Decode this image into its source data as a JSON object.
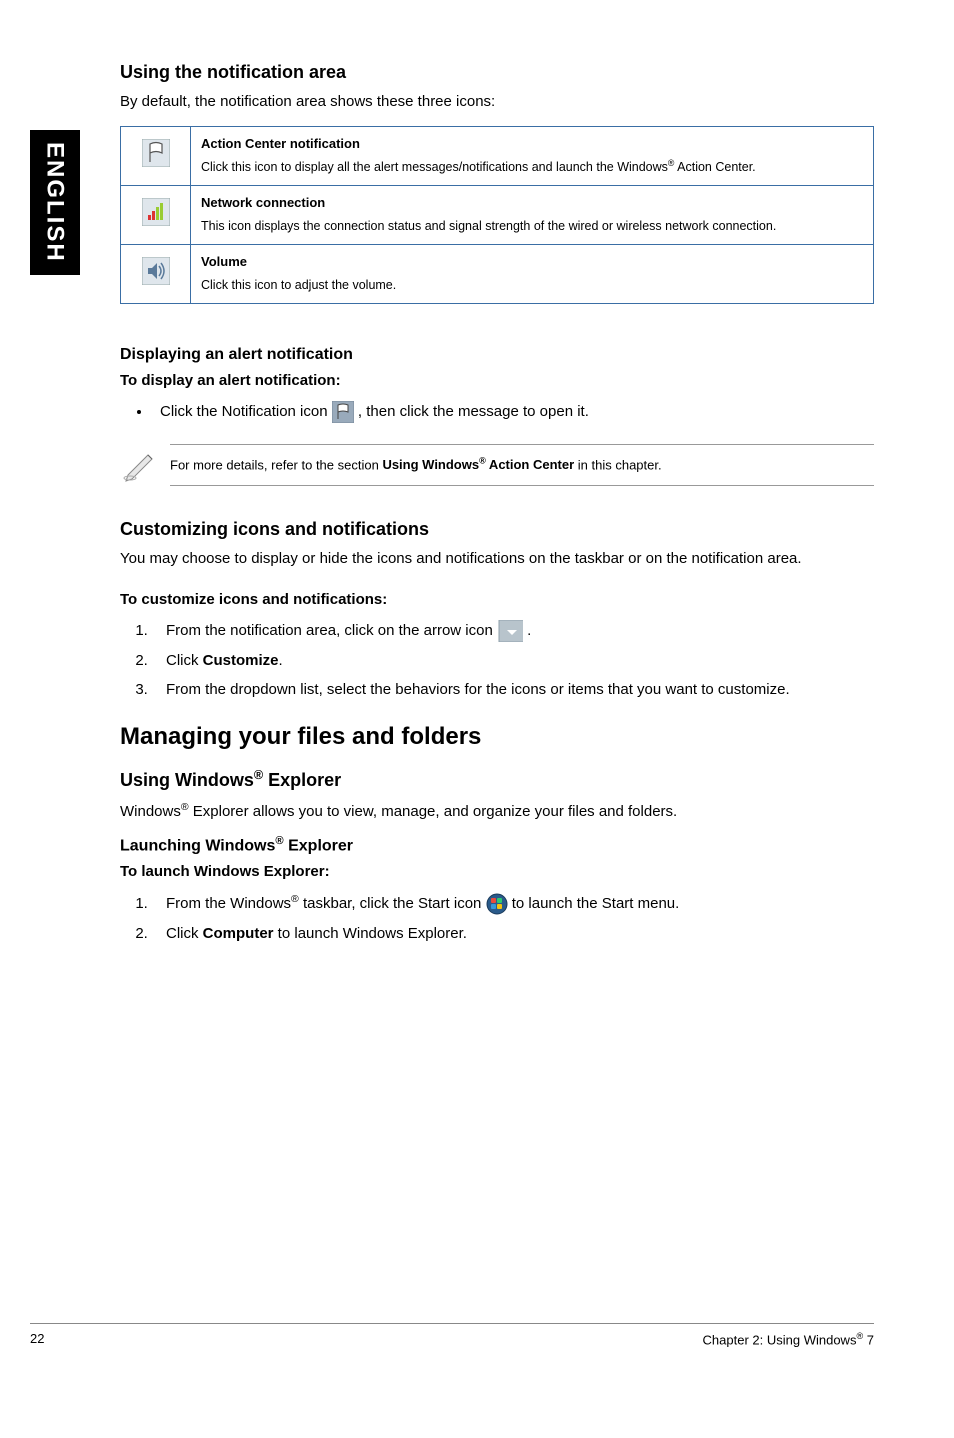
{
  "side_label": "ENGLISH",
  "sec1": {
    "title": "Using the notification area",
    "intro": "By default, the notification area shows these three icons:"
  },
  "table": {
    "rows": [
      {
        "title": "Action Center notification",
        "desc_pre": "Click this icon to display all the alert messages/notifications and launch the Windows",
        "desc_post": " Action Center."
      },
      {
        "title": "Network connection",
        "desc": "This icon displays the connection status and signal strength of the wired or wireless network connection."
      },
      {
        "title": "Volume",
        "desc": "Click this icon to adjust the volume."
      }
    ]
  },
  "alert": {
    "heading": "Displaying an alert notification",
    "sub": "To display an alert notification:",
    "bullet_pre": "Click the Notification icon ",
    "bullet_post": ", then click the message to open it."
  },
  "note": {
    "pre": "For more details, refer to the section ",
    "bold_pre": "Using Windows",
    "bold_post": " Action Center",
    "post": " in this chapter."
  },
  "customize": {
    "title": "Customizing icons and notifications",
    "intro": "You may choose to display or hide the icons and notifications on the taskbar or on the notification area.",
    "steps_title": "To customize icons and notifications:",
    "steps": [
      {
        "pre": "From the notification area, click on the arrow icon ",
        "post": "."
      },
      {
        "pre": "Click ",
        "bold": "Customize",
        "post": "."
      },
      {
        "text": "From the dropdown list, select the behaviors for the icons or items that you want to customize."
      }
    ]
  },
  "managing": {
    "title": "Managing your files and folders",
    "explorer_title_pre": "Using Windows",
    "explorer_title_post": " Explorer",
    "explorer_intro_pre": "Windows",
    "explorer_intro_post": " Explorer allows you to view, manage, and organize your files and folders.",
    "launch_title_pre": "Launching Windows",
    "launch_title_post": " Explorer",
    "launch_sub": "To launch Windows Explorer:",
    "steps": [
      {
        "pre": "From the Windows",
        "mid": " taskbar, click the Start icon ",
        "post": " to launch the Start menu."
      },
      {
        "pre": "Click ",
        "bold": "Computer",
        "post": " to launch Windows Explorer."
      }
    ]
  },
  "footer": {
    "page": "22",
    "chapter_pre": "Chapter 2: Using Windows",
    "chapter_post": " 7"
  }
}
